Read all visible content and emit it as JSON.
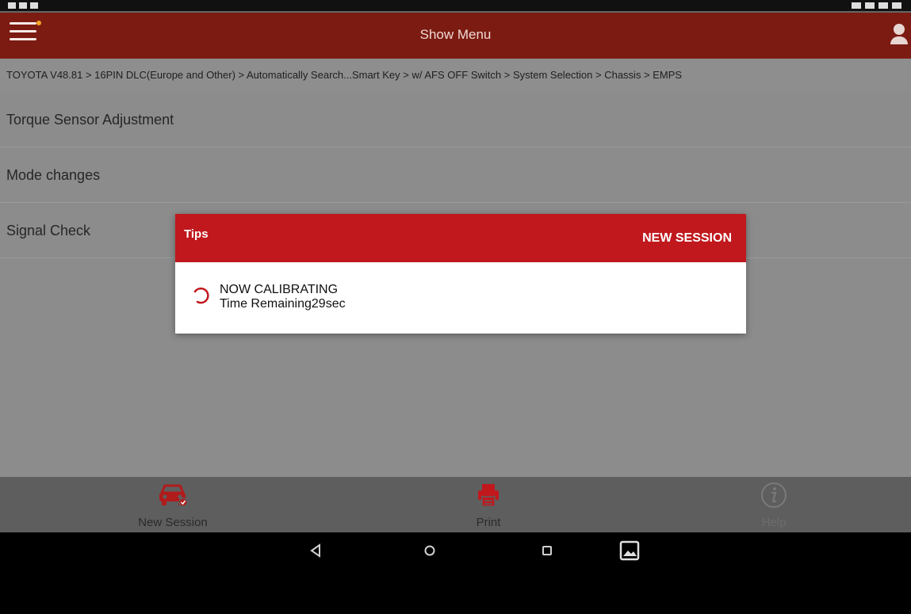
{
  "header": {
    "title": "Show Menu"
  },
  "breadcrumb": {
    "text": "TOYOTA V48.81 > 16PIN DLC(Europe and Other) > Automatically Search...Smart Key > w/ AFS OFF Switch > System Selection > Chassis > EMPS"
  },
  "list": {
    "items": [
      {
        "label": "Torque Sensor Adjustment"
      },
      {
        "label": "Mode changes"
      },
      {
        "label": "Signal Check"
      }
    ]
  },
  "dialog": {
    "title": "Tips",
    "action_label": "NEW SESSION",
    "message_line1": "NOW CALIBRATING",
    "message_line2": "Time Remaining29sec"
  },
  "toolbar": {
    "new_session_label": "New Session",
    "print_label": "Print",
    "help_label": "Help"
  },
  "colors": {
    "header": "#7b1b12",
    "dialog_header": "#c0181d",
    "accent_red": "#c0181d"
  },
  "icons": {
    "menu": "hamburger-icon",
    "user": "user-icon",
    "spinner": "loading-spinner-icon",
    "new_session": "car-icon",
    "print": "printer-icon",
    "help": "info-icon",
    "nav_back": "back-triangle-icon",
    "nav_home": "home-circle-icon",
    "nav_recent": "recent-square-icon",
    "nav_screenshot": "image-icon"
  }
}
